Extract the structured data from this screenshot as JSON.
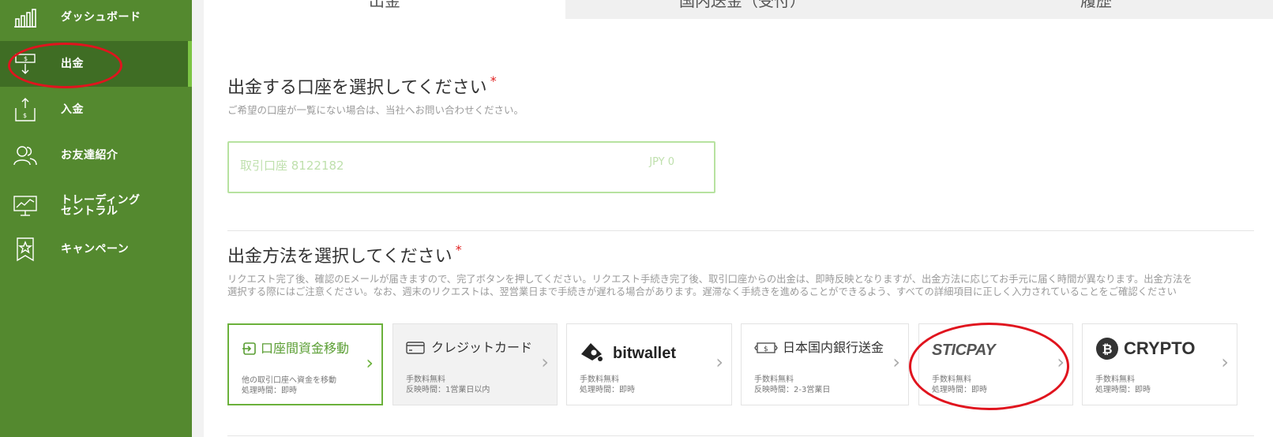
{
  "sidebar": {
    "items": [
      {
        "label": "ダッシュボード",
        "icon": "bar-chart-icon"
      },
      {
        "label": "出金",
        "icon": "withdraw-icon",
        "active": true
      },
      {
        "label": "入金",
        "icon": "deposit-icon"
      },
      {
        "label": "お友達紹介",
        "icon": "users-icon"
      },
      {
        "label": "トレーディング\nセントラル",
        "icon": "monitor-chart-icon"
      },
      {
        "label": "キャンペーン",
        "icon": "bookmark-star-icon"
      }
    ]
  },
  "tabs": [
    {
      "label": "出金",
      "active": true
    },
    {
      "label": "国内送金（受付）",
      "active": false
    },
    {
      "label": "履歴",
      "active": false
    }
  ],
  "account_section": {
    "title": "出金する口座を選択してください",
    "required_mark": "*",
    "hint": "ご希望の口座が一覧にない場合は、当社へお問い合わせください。",
    "selected_account": "取引口座 8122182",
    "balance": "JPY 0"
  },
  "method_section": {
    "title": "出金方法を選択してください",
    "required_mark": "*",
    "hint_line1": "リクエスト完了後、確認のEメールが届きますので、完了ボタンを押してください。リクエスト手続き完了後、取引口座からの出金は、即時反映となりますが、出金方法に応じてお手元に届く時間が異なります。出金方法を",
    "hint_line2": "選択する際にはご注意ください。なお、週末のリクエストは、翌営業日まで手続きが遅れる場合があります。遅滞なく手続きを進めることができるよう、すべての詳細項目に正しく入力されていることをご確認ください",
    "methods": [
      {
        "title": "口座間資金移動",
        "line1": "他の取引口座へ資金を移動",
        "line2": "処理時間：即時",
        "icon": "transfer-icon",
        "selected": true
      },
      {
        "title": "クレジットカード",
        "line1": "手数料無料",
        "line2": "反映時間：1営業日以内",
        "icon": "credit-card-icon"
      },
      {
        "title": "bitwallet",
        "line1": "手数料無料",
        "line2": "処理時間：即時",
        "icon": "bitwallet-logo-icon"
      },
      {
        "title": "日本国内銀行送金",
        "line1": "手数料無料",
        "line2": "反映時間：2-3営業日",
        "icon": "banknote-icon"
      },
      {
        "title": "STICPAY",
        "line1": "手数料無料",
        "line2": "処理時間：即時",
        "icon": "sticpay-logo-icon"
      },
      {
        "title": "CRYPTO",
        "line1": "手数料無料",
        "line2": "処理時間：即時",
        "icon": "bitcoin-icon"
      }
    ]
  },
  "colors": {
    "sidebar_bg": "#54892f",
    "sidebar_active": "#3f6d24",
    "accent": "#6bb13b",
    "annotation": "#e0141e"
  }
}
